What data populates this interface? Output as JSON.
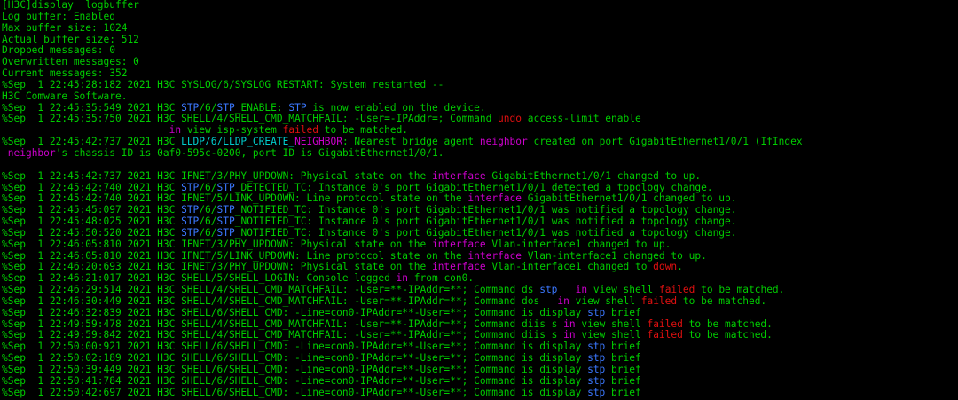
{
  "terminal": {
    "colors": {
      "background": "#000000",
      "default": "#00cc00",
      "cyan": "#00cccc",
      "blue": "#3b78ff",
      "magenta": "#cc00cc",
      "red": "#e01010",
      "partial_top": "#c0c000"
    },
    "lines": [
      [
        {
          "t": "[H3C]display  logbuffer"
        }
      ],
      [
        {
          "t": "Log buffer: Enabled"
        }
      ],
      [
        {
          "t": "Max buffer size: 1024"
        }
      ],
      [
        {
          "t": "Actual buffer size: 512"
        }
      ],
      [
        {
          "t": "Dropped messages: 0"
        }
      ],
      [
        {
          "t": "Overwritten messages: 0"
        }
      ],
      [
        {
          "t": "Current messages: 352"
        }
      ],
      [
        {
          "t": "%Sep  1 22:45:28:182 2021 H3C SYSLOG/6/SYSLOG_RESTART: System restarted --"
        }
      ],
      [
        {
          "t": "H3C Comware Software."
        }
      ],
      [
        {
          "t": "%Sep  1 22:45:35:549 2021 H3C "
        },
        {
          "t": "STP",
          "c": "blue"
        },
        {
          "t": "/6/"
        },
        {
          "t": "STP",
          "c": "blue"
        },
        {
          "t": "_ENABLE: "
        },
        {
          "t": "STP",
          "c": "blue"
        },
        {
          "t": " is now enabled on the device."
        }
      ],
      [
        {
          "t": "%Sep  1 22:45:35:750 2021 H3C SHELL/4/SHELL_CMD_MATCHFAIL: -User=-IPAddr=; Command "
        },
        {
          "t": "undo",
          "c": "red"
        },
        {
          "t": " access-limit enable"
        }
      ],
      [
        {
          "t": "                            "
        },
        {
          "t": "in",
          "c": "magenta"
        },
        {
          "t": " view isp-system "
        },
        {
          "t": "failed",
          "c": "red"
        },
        {
          "t": " to be matched."
        }
      ],
      [
        {
          "t": "%Sep  1 22:45:42:737 2021 H3C "
        },
        {
          "t": "LLDP/6/LLDP_CREATE_",
          "c": "cyan"
        },
        {
          "t": "NEIGHBOR",
          "c": "magenta"
        },
        {
          "t": ": Nearest bridge agent "
        },
        {
          "t": "neighbor",
          "c": "magenta"
        },
        {
          "t": " created on port GigabitEthernet1/0/1 (IfIndex"
        }
      ],
      [
        {
          "t": " "
        },
        {
          "t": "neighbor",
          "c": "magenta"
        },
        {
          "t": "'s chassis ID is 0af0-595c-0200, port ID is GigabitEthernet1/0/1."
        }
      ],
      [
        {
          "t": ""
        }
      ],
      [
        {
          "t": "%Sep  1 22:45:42:737 2021 H3C IFNET/3/PHY_UPDOWN: Physical state on the "
        },
        {
          "t": "interface",
          "c": "magenta"
        },
        {
          "t": " GigabitEthernet1/0/1 changed to up."
        }
      ],
      [
        {
          "t": "%Sep  1 22:45:42:740 2021 H3C "
        },
        {
          "t": "STP",
          "c": "blue"
        },
        {
          "t": "/6/"
        },
        {
          "t": "STP",
          "c": "blue"
        },
        {
          "t": "_DETECTED_TC: Instance 0's port GigabitEthernet1/0/1 detected a topology change."
        }
      ],
      [
        {
          "t": "%Sep  1 22:45:42:740 2021 H3C IFNET/5/LINK_UPDOWN: Line protocol state on the "
        },
        {
          "t": "interface",
          "c": "magenta"
        },
        {
          "t": " GigabitEthernet1/0/1 changed to up."
        }
      ],
      [
        {
          "t": "%Sep  1 22:45:45:097 2021 H3C "
        },
        {
          "t": "STP",
          "c": "blue"
        },
        {
          "t": "/6/"
        },
        {
          "t": "STP",
          "c": "blue"
        },
        {
          "t": "_NOTIFIED_TC: Instance 0's port GigabitEthernet1/0/1 was notified a topology change."
        }
      ],
      [
        {
          "t": "%Sep  1 22:45:48:025 2021 H3C "
        },
        {
          "t": "STP",
          "c": "blue"
        },
        {
          "t": "/6/"
        },
        {
          "t": "STP",
          "c": "blue"
        },
        {
          "t": "_NOTIFIED_TC: Instance 0's port GigabitEthernet1/0/1 was notified a topology change."
        }
      ],
      [
        {
          "t": "%Sep  1 22:45:50:520 2021 H3C "
        },
        {
          "t": "STP",
          "c": "blue"
        },
        {
          "t": "/6/"
        },
        {
          "t": "STP",
          "c": "blue"
        },
        {
          "t": "_NOTIFIED_TC: Instance 0's port GigabitEthernet1/0/1 was notified a topology change."
        }
      ],
      [
        {
          "t": "%Sep  1 22:46:05:810 2021 H3C IFNET/3/PHY_UPDOWN: Physical state on the "
        },
        {
          "t": "interface",
          "c": "magenta"
        },
        {
          "t": " Vlan-interface1 changed to up."
        }
      ],
      [
        {
          "t": "%Sep  1 22:46:05:810 2021 H3C IFNET/5/LINK_UPDOWN: Line protocol state on the "
        },
        {
          "t": "interface",
          "c": "magenta"
        },
        {
          "t": " Vlan-interface1 changed to up."
        }
      ],
      [
        {
          "t": "%Sep  1 22:46:20:693 2021 H3C IFNET/3/PHY_UPDOWN: Physical state on the "
        },
        {
          "t": "interface",
          "c": "magenta"
        },
        {
          "t": " Vlan-interface1 changed to "
        },
        {
          "t": "down",
          "c": "red"
        },
        {
          "t": "."
        }
      ],
      [
        {
          "t": "%Sep  1 22:46:21:017 2021 H3C SHELL/5/SHELL_LOGIN: Console logged "
        },
        {
          "t": "in",
          "c": "magenta"
        },
        {
          "t": " from con0."
        }
      ],
      [
        {
          "t": "%Sep  1 22:46:29:514 2021 H3C SHELL/4/SHELL_CMD_MATCHFAIL: -User=**-IPAddr=**; Command ds "
        },
        {
          "t": "stp",
          "c": "blue"
        },
        {
          "t": "   "
        },
        {
          "t": "in",
          "c": "magenta"
        },
        {
          "t": " view shell "
        },
        {
          "t": "failed",
          "c": "red"
        },
        {
          "t": " to be matched."
        }
      ],
      [
        {
          "t": "%Sep  1 22:46:30:449 2021 H3C SHELL/4/SHELL_CMD_MATCHFAIL: -User=**-IPAddr=**; Command dos   "
        },
        {
          "t": "in",
          "c": "magenta"
        },
        {
          "t": " view shell "
        },
        {
          "t": "failed",
          "c": "red"
        },
        {
          "t": " to be matched."
        }
      ],
      [
        {
          "t": "%Sep  1 22:46:32:839 2021 H3C SHELL/6/SHELL_CMD: -Line=con0-IPAddr=**-User=**; Command is display "
        },
        {
          "t": "stp",
          "c": "blue"
        },
        {
          "t": " brief"
        }
      ],
      [
        {
          "t": "%Sep  1 22:49:59:478 2021 H3C SHELL/4/SHELL_CMD_MATCHFAIL: -User=**-IPAddr=**; Command diis s "
        },
        {
          "t": "in",
          "c": "magenta"
        },
        {
          "t": " view shell "
        },
        {
          "t": "failed",
          "c": "red"
        },
        {
          "t": " to be matched."
        }
      ],
      [
        {
          "t": "%Sep  1 22:49:59:842 2021 H3C SHELL/4/SHELL_CMD_MATCHFAIL: -User=**-IPAddr=**; Command diis s "
        },
        {
          "t": "in",
          "c": "magenta"
        },
        {
          "t": " view shell "
        },
        {
          "t": "failed",
          "c": "red"
        },
        {
          "t": " to be matched."
        }
      ],
      [
        {
          "t": "%Sep  1 22:50:00:921 2021 H3C SHELL/6/SHELL_CMD: -Line=con0-IPAddr=**-User=**; Command is display "
        },
        {
          "t": "stp",
          "c": "blue"
        },
        {
          "t": " brief"
        }
      ],
      [
        {
          "t": "%Sep  1 22:50:02:189 2021 H3C SHELL/6/SHELL_CMD: -Line=con0-IPAddr=**-User=**; Command is display "
        },
        {
          "t": "stp",
          "c": "blue"
        },
        {
          "t": " brief"
        }
      ],
      [
        {
          "t": "%Sep  1 22:50:39:449 2021 H3C SHELL/6/SHELL_CMD: -Line=con0-IPAddr=**-User=**; Command is display "
        },
        {
          "t": "stp",
          "c": "blue"
        },
        {
          "t": " brief"
        }
      ],
      [
        {
          "t": "%Sep  1 22:50:41:784 2021 H3C SHELL/6/SHELL_CMD: -Line=con0-IPAddr=**-User=**; Command is display "
        },
        {
          "t": "stp",
          "c": "blue"
        },
        {
          "t": " brief"
        }
      ],
      [
        {
          "t": "%Sep  1 22:50:42:697 2021 H3C SHELL/6/SHELL_CMD: -Line=con0-IPAddr=**-User=**; Command is display "
        },
        {
          "t": "stp",
          "c": "blue"
        },
        {
          "t": " brief"
        }
      ]
    ]
  }
}
